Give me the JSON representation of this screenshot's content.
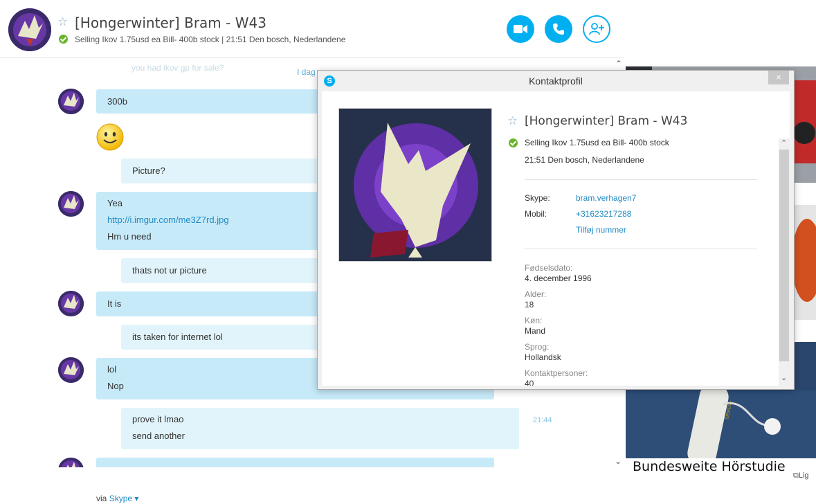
{
  "header": {
    "title": "[Hongerwinter] Bram - W43",
    "mood": "Selling Ikov 1.75usd ea Bill- 400b stock | 21:51 Den bosch, Nederlandene"
  },
  "chat": {
    "faded_top": "you had ikov gp for sale?",
    "date_marker": "I dag",
    "messages": [
      {
        "dir": "in",
        "lines": [
          "300b"
        ]
      },
      {
        "dir": "out",
        "lines": [
          "Picture?"
        ]
      },
      {
        "dir": "in",
        "lines": [
          "Yea",
          "http://i.imgur.com/me3Z7rd.jpg",
          "Hm u need"
        ]
      },
      {
        "dir": "out",
        "lines": [
          "thats not ur picture"
        ]
      },
      {
        "dir": "in",
        "lines": [
          "It is"
        ]
      },
      {
        "dir": "out",
        "lines": [
          "its taken for internet lol"
        ]
      },
      {
        "dir": "in",
        "lines": [
          "lol",
          "Nop"
        ]
      },
      {
        "dir": "out",
        "lines": [
          "prove it lmao",
          "send another"
        ],
        "time": "21:44"
      }
    ],
    "via_label": "via",
    "via_link": "Skype"
  },
  "modal": {
    "title": "Kontaktprofil",
    "close": "×",
    "name": "[Hongerwinter] Bram - W43",
    "mood": "Selling Ikov 1.75usd ea Bill- 400b stock",
    "location": "21:51 Den bosch, Nederlandene",
    "skype_label": "Skype:",
    "skype_value": "bram.verhagen7",
    "mobile_label": "Mobil:",
    "mobile_value": "+31623217288",
    "add_number": "Tilføj nummer",
    "birthday_label": "Fødselsdato:",
    "birthday_value": "4. december 1996",
    "age_label": "Alder:",
    "age_value": "18",
    "gender_label": "Køn:",
    "gender_value": "Mand",
    "language_label": "Sprog:",
    "language_value": "Hollandsk",
    "contacts_label": "Kontaktpersoner:",
    "contacts_value": "40"
  },
  "ad": {
    "headline": "Bundesweite Hörstudie",
    "brand": "SIEMENS",
    "corner": "Lig"
  },
  "colors": {
    "accent": "#00aff0",
    "bubble_in": "#c7eaf9",
    "bubble_out": "#e1f4fb",
    "online": "#6ab42d"
  }
}
